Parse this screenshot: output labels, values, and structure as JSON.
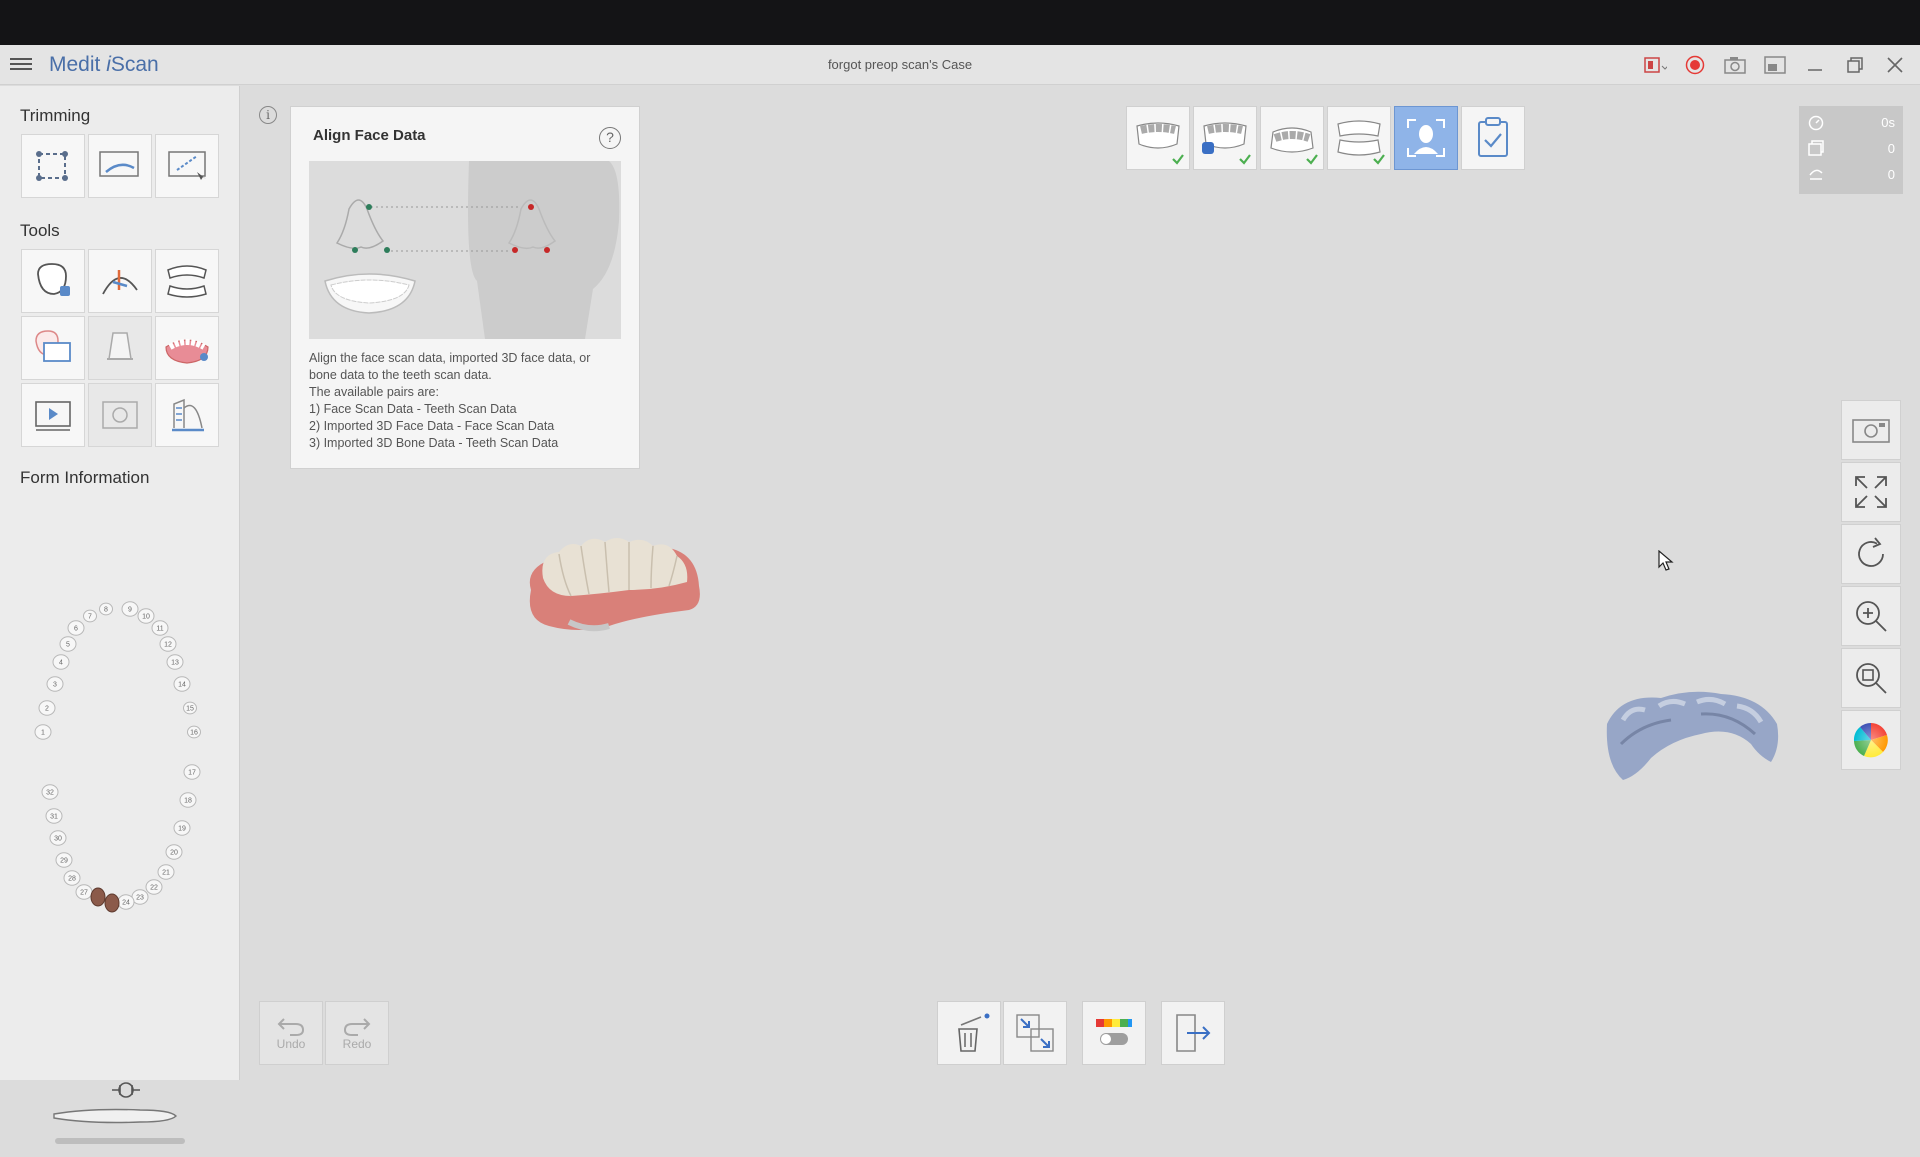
{
  "app": {
    "title_prefix": "Medit ",
    "title_i": "i",
    "title_suffix": "Scan",
    "case_title": "forgot preop scan's Case"
  },
  "sidebar": {
    "trimming_title": "Trimming",
    "tools_title": "Tools",
    "form_info_title": "Form Information",
    "upper_teeth": [
      "1",
      "2",
      "3",
      "4",
      "5",
      "6",
      "7",
      "8",
      "9",
      "10",
      "11",
      "12",
      "13",
      "14",
      "15",
      "16"
    ],
    "lower_teeth": [
      "17",
      "18",
      "19",
      "20",
      "21",
      "22",
      "23",
      "24",
      "27",
      "28",
      "29",
      "30",
      "31",
      "32"
    ]
  },
  "panel": {
    "title": "Align Face Data",
    "help_label": "?",
    "info_label": "i",
    "description": [
      "Align the face scan data, imported 3D face data, or",
      "bone data to the teeth scan data.",
      "The available pairs are:",
      "1) Face Scan Data - Teeth Scan Data",
      "2) Imported 3D Face Data - Face Scan Data",
      "3) Imported 3D Bone Data - Teeth Scan Data"
    ]
  },
  "counters": {
    "time": "0s",
    "count_a": "0",
    "count_b": "0"
  },
  "actions": {
    "undo": "Undo",
    "redo": "Redo"
  },
  "colors": {
    "accent": "#4a6fa8",
    "active_step": "#8fb4e8",
    "check": "#4caf50",
    "record": "#e53935"
  },
  "icons": [
    "menu-icon",
    "layout-icon",
    "record-icon",
    "camera-icon",
    "window-icon",
    "minimize-icon",
    "maximize-icon",
    "close-icon"
  ]
}
